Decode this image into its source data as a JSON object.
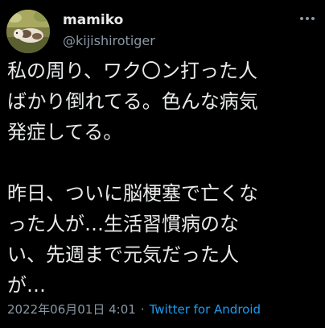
{
  "user": {
    "display_name": "mamiko",
    "handle": "@kijishirotiger"
  },
  "tweet": {
    "lines": [
      "私の周り、ワク〇ン打った人",
      "ばかり倒れてる。色んな病気",
      "発症してる。",
      "",
      "昨日、ついに脳梗塞で亡くな",
      "った人が…生活習慣病のな",
      "い、先週まで元気だった人",
      "が…"
    ],
    "timestamp": "2022年06月01日 4:01",
    "separator": "·",
    "source": "Twitter for Android"
  },
  "icons": {
    "avatar": "avatar-photo",
    "more": "more-options-icon"
  },
  "colors": {
    "background": "#000000",
    "text": "#e7e9ea",
    "muted": "#8b98a5",
    "link": "#1d9bf0"
  }
}
